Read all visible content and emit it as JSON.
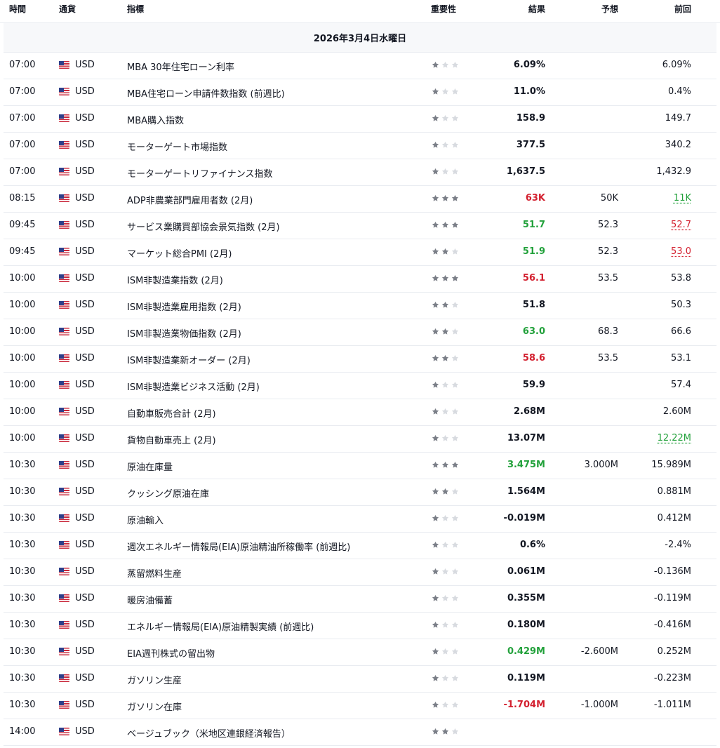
{
  "header": {
    "time": "時間",
    "currency": "通貨",
    "indicator": "指標",
    "importance": "重要性",
    "actual": "結果",
    "forecast": "予想",
    "previous": "前回"
  },
  "date_label": "2026年3月4日水曜日",
  "colors": {
    "star_filled": "#7b7f88",
    "star_empty": "#d8dbe0",
    "red": "#d3202f",
    "green": "#22a13b"
  },
  "rows": [
    {
      "time": "07:00",
      "currency": "USD",
      "indicator": "MBA 30年住宅ローン利率",
      "importance": 1,
      "actual": "6.09%",
      "actual_color": "black",
      "forecast": "",
      "previous": "6.09%",
      "previous_style": ""
    },
    {
      "time": "07:00",
      "currency": "USD",
      "indicator": "MBA住宅ローン申請件数指数 (前週比)",
      "importance": 1,
      "actual": "11.0%",
      "actual_color": "black",
      "forecast": "",
      "previous": "0.4%",
      "previous_style": ""
    },
    {
      "time": "07:00",
      "currency": "USD",
      "indicator": "MBA購入指数",
      "importance": 1,
      "actual": "158.9",
      "actual_color": "black",
      "forecast": "",
      "previous": "149.7",
      "previous_style": ""
    },
    {
      "time": "07:00",
      "currency": "USD",
      "indicator": "モーターゲート市場指数",
      "importance": 1,
      "actual": "377.5",
      "actual_color": "black",
      "forecast": "",
      "previous": "340.2",
      "previous_style": ""
    },
    {
      "time": "07:00",
      "currency": "USD",
      "indicator": "モーターゲートリファイナンス指数",
      "importance": 1,
      "actual": "1,637.5",
      "actual_color": "black",
      "forecast": "",
      "previous": "1,432.9",
      "previous_style": ""
    },
    {
      "time": "08:15",
      "currency": "USD",
      "indicator": "ADP非農業部門雇用者数 (2月)",
      "importance": 3,
      "actual": "63K",
      "actual_color": "red",
      "forecast": "50K",
      "previous": "11K",
      "previous_style": "green"
    },
    {
      "time": "09:45",
      "currency": "USD",
      "indicator": "サービス業購買部協会景気指数 (2月)",
      "importance": 3,
      "actual": "51.7",
      "actual_color": "green",
      "forecast": "52.3",
      "previous": "52.7",
      "previous_style": "red"
    },
    {
      "time": "09:45",
      "currency": "USD",
      "indicator": "マーケット総合PMI (2月)",
      "importance": 2,
      "actual": "51.9",
      "actual_color": "green",
      "forecast": "52.3",
      "previous": "53.0",
      "previous_style": "red"
    },
    {
      "time": "10:00",
      "currency": "USD",
      "indicator": "ISM非製造業指数 (2月)",
      "importance": 3,
      "actual": "56.1",
      "actual_color": "red",
      "forecast": "53.5",
      "previous": "53.8",
      "previous_style": ""
    },
    {
      "time": "10:00",
      "currency": "USD",
      "indicator": "ISM非製造業雇用指数 (2月)",
      "importance": 2,
      "actual": "51.8",
      "actual_color": "black",
      "forecast": "",
      "previous": "50.3",
      "previous_style": ""
    },
    {
      "time": "10:00",
      "currency": "USD",
      "indicator": "ISM非製造業物価指数 (2月)",
      "importance": 2,
      "actual": "63.0",
      "actual_color": "green",
      "forecast": "68.3",
      "previous": "66.6",
      "previous_style": ""
    },
    {
      "time": "10:00",
      "currency": "USD",
      "indicator": "ISM非製造業新オーダー (2月)",
      "importance": 2,
      "actual": "58.6",
      "actual_color": "red",
      "forecast": "53.5",
      "previous": "53.1",
      "previous_style": ""
    },
    {
      "time": "10:00",
      "currency": "USD",
      "indicator": "ISM非製造業ビジネス活動 (2月)",
      "importance": 1,
      "actual": "59.9",
      "actual_color": "black",
      "forecast": "",
      "previous": "57.4",
      "previous_style": ""
    },
    {
      "time": "10:00",
      "currency": "USD",
      "indicator": "自動車販売合計 (2月)",
      "importance": 1,
      "actual": "2.68M",
      "actual_color": "black",
      "forecast": "",
      "previous": "2.60M",
      "previous_style": ""
    },
    {
      "time": "10:00",
      "currency": "USD",
      "indicator": "貨物自動車売上 (2月)",
      "importance": 1,
      "actual": "13.07M",
      "actual_color": "black",
      "forecast": "",
      "previous": "12.22M",
      "previous_style": "green"
    },
    {
      "time": "10:30",
      "currency": "USD",
      "indicator": "原油在庫量",
      "importance": 3,
      "actual": "3.475M",
      "actual_color": "green",
      "forecast": "3.000M",
      "previous": "15.989M",
      "previous_style": ""
    },
    {
      "time": "10:30",
      "currency": "USD",
      "indicator": "クッシング原油在庫",
      "importance": 2,
      "actual": "1.564M",
      "actual_color": "black",
      "forecast": "",
      "previous": "0.881M",
      "previous_style": ""
    },
    {
      "time": "10:30",
      "currency": "USD",
      "indicator": "原油輸入",
      "importance": 1,
      "actual": "-0.019M",
      "actual_color": "black",
      "forecast": "",
      "previous": "0.412M",
      "previous_style": ""
    },
    {
      "time": "10:30",
      "currency": "USD",
      "indicator": "週次エネルギー情報局(EIA)原油精油所稼働率 (前週比)",
      "importance": 1,
      "actual": "0.6%",
      "actual_color": "black",
      "forecast": "",
      "previous": "-2.4%",
      "previous_style": ""
    },
    {
      "time": "10:30",
      "currency": "USD",
      "indicator": "蒸留燃料生産",
      "importance": 1,
      "actual": "0.061M",
      "actual_color": "black",
      "forecast": "",
      "previous": "-0.136M",
      "previous_style": ""
    },
    {
      "time": "10:30",
      "currency": "USD",
      "indicator": "暖房油備蓄",
      "importance": 1,
      "actual": "0.355M",
      "actual_color": "black",
      "forecast": "",
      "previous": "-0.119M",
      "previous_style": ""
    },
    {
      "time": "10:30",
      "currency": "USD",
      "indicator": "エネルギー情報局(EIA)原油精製実績 (前週比)",
      "importance": 1,
      "actual": "0.180M",
      "actual_color": "black",
      "forecast": "",
      "previous": "-0.416M",
      "previous_style": ""
    },
    {
      "time": "10:30",
      "currency": "USD",
      "indicator": "EIA週刊株式の留出物",
      "importance": 1,
      "actual": "0.429M",
      "actual_color": "green",
      "forecast": "-2.600M",
      "previous": "0.252M",
      "previous_style": ""
    },
    {
      "time": "10:30",
      "currency": "USD",
      "indicator": "ガソリン生産",
      "importance": 1,
      "actual": "0.119M",
      "actual_color": "black",
      "forecast": "",
      "previous": "-0.223M",
      "previous_style": ""
    },
    {
      "time": "10:30",
      "currency": "USD",
      "indicator": "ガソリン在庫",
      "importance": 1,
      "actual": "-1.704M",
      "actual_color": "red",
      "forecast": "-1.000M",
      "previous": "-1.011M",
      "previous_style": ""
    },
    {
      "time": "14:00",
      "currency": "USD",
      "indicator": "ベージュブック（米地区連銀経済報告）",
      "importance": 2,
      "actual": "",
      "actual_color": "black",
      "forecast": "",
      "previous": "",
      "previous_style": ""
    }
  ]
}
